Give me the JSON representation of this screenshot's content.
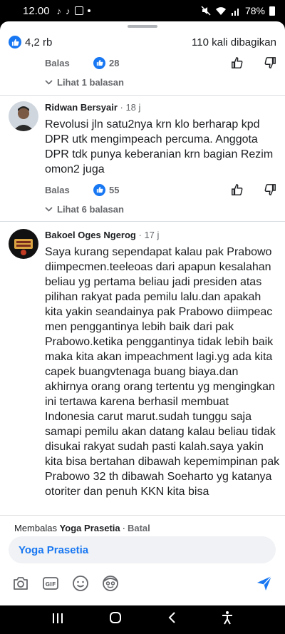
{
  "status": {
    "time": "12.00",
    "battery": "78%"
  },
  "post_stats": {
    "reactions": "4,2 rb",
    "shares": "110 kali dibagikan"
  },
  "comment_prev": {
    "reply_label": "Balas",
    "likes": "28",
    "view_replies": "Lihat 1 balasan"
  },
  "comment1": {
    "author": "Ridwan Bersyair",
    "time": "18 j",
    "text": "Revolusi jln satu2nya krn klo berharap kpd DPR utk mengimpeach percuma. Anggota DPR tdk punya keberanian krn bagian Rezim omon2 juga",
    "reply_label": "Balas",
    "likes": "55",
    "view_replies": "Lihat 6 balasan"
  },
  "comment2": {
    "author": "Bakoel Oges Ngerog",
    "time": "17 j",
    "text": "Saya kurang sependapat kalau pak Prabowo diimpecmen.teeleoas dari apapun kesalahan beliau yg pertama beliau jadi presiden atas pilihan rakyat pada pemilu lalu.dan apakah kita yakin seandainya pak Prabowo diimpeac men penggantinya lebih baik dari pak Prabowo.ketika penggantinya tidak lebih baik maka kita akan impeachment lagi.yg ada kita capek buangvtenaga buang biaya.dan akhirnya orang orang tertentu yg mengingkan ini tertawa karena berhasil membuat Indonesia carut marut.sudah tunggu saja samapi pemilu akan datang kalau beliau tidak disukai rakyat sudah pasti kalah.saya yakin kita bisa bertahan dibawah kepemimpinan pak Prabowo 32 th dibawah Soeharto yg katanya otoriter dan penuh KKN kita bisa"
  },
  "composer": {
    "replying_prefix": "Membalas",
    "replying_to": "Yoga Prasetia",
    "cancel": "Batal",
    "input_value": "Yoga Prasetia"
  },
  "colors": {
    "accent": "#1877f2",
    "muted": "#65676b",
    "input_bg": "#f0f2f5"
  }
}
